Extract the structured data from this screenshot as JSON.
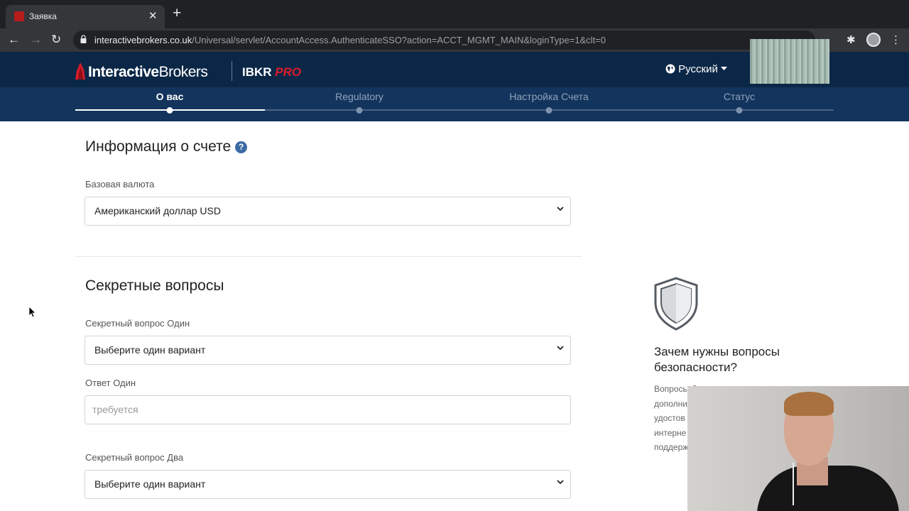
{
  "browser": {
    "tab_title": "Заявка",
    "close_glyph": "✕",
    "new_tab_glyph": "+",
    "back_glyph": "←",
    "forward_glyph": "→",
    "reload_glyph": "↻",
    "url_host": "interactivebrokers.co.uk",
    "url_path": "/Universal/servlet/AccountAccess.AuthenticateSSO?action=ACCT_MGMT_MAIN&loginType=1&clt=0",
    "extension_glyph": "✱",
    "menu_glyph": "⋮"
  },
  "header": {
    "logo_bold": "Interactive",
    "logo_light": "Brokers",
    "ibkr": "IBKR",
    "pro": "PRO",
    "language": "Русский"
  },
  "steps": [
    {
      "label": "О вас"
    },
    {
      "label": "Regulatory"
    },
    {
      "label": "Настройка Счета"
    },
    {
      "label": "Статус"
    }
  ],
  "account_info": {
    "title": "Информация о счете",
    "help": "?",
    "currency_label": "Базовая валюта",
    "currency_value": "Американский доллар USD"
  },
  "security": {
    "title": "Секретные вопросы",
    "q1_label": "Секретный вопрос Один",
    "q1_value": "Выберите один вариант",
    "a1_label": "Ответ Один",
    "a1_placeholder": "требуется",
    "q2_label": "Секретный вопрос Два",
    "q2_value": "Выберите один вариант"
  },
  "side": {
    "title": "Зачем нужны вопросы безопасности?",
    "lines": [
      "Вопросы б",
      "дополни",
      "удостов",
      "интерне",
      "поддерж"
    ]
  },
  "colors": {
    "header_bg": "#0b2747",
    "steps_bg": "#13345c",
    "brand_red": "#d81c2a"
  }
}
